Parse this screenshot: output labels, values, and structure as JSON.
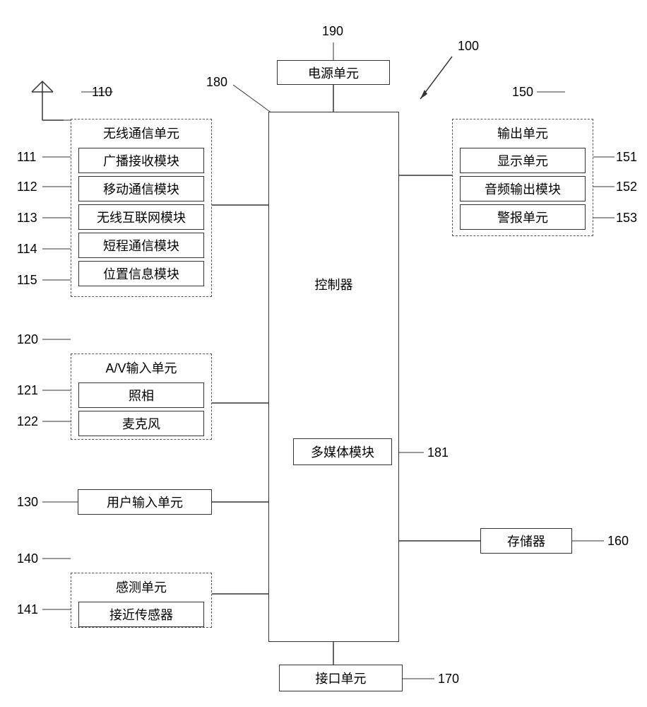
{
  "refs": {
    "r190": "190",
    "r100": "100",
    "r180": "180",
    "r150": "150",
    "r110": "110",
    "r111": "111",
    "r112": "112",
    "r113": "113",
    "r114": "114",
    "r115": "115",
    "r120": "120",
    "r121": "121",
    "r122": "122",
    "r130": "130",
    "r140": "140",
    "r141": "141",
    "r151": "151",
    "r152": "152",
    "r153": "153",
    "r160": "160",
    "r170": "170",
    "r181": "181"
  },
  "blocks": {
    "power": "电源单元",
    "controller": "控制器",
    "multimedia": "多媒体模块",
    "wireless_group": "无线通信单元",
    "wireless": {
      "broadcast": "广播接收模块",
      "mobile": "移动通信模块",
      "internet": "无线互联网模块",
      "shortrange": "短程通信模块",
      "location": "位置信息模块"
    },
    "av_group": "A/V输入单元",
    "av": {
      "camera": "照相",
      "mic": "麦克风"
    },
    "user_input": "用户输入单元",
    "sense_group": "感测单元",
    "sense": {
      "proximity": "接近传感器"
    },
    "output_group": "输出单元",
    "output": {
      "display": "显示单元",
      "audio": "音频输出模块",
      "alarm": "警报单元"
    },
    "memory": "存储器",
    "interface": "接口单元"
  }
}
